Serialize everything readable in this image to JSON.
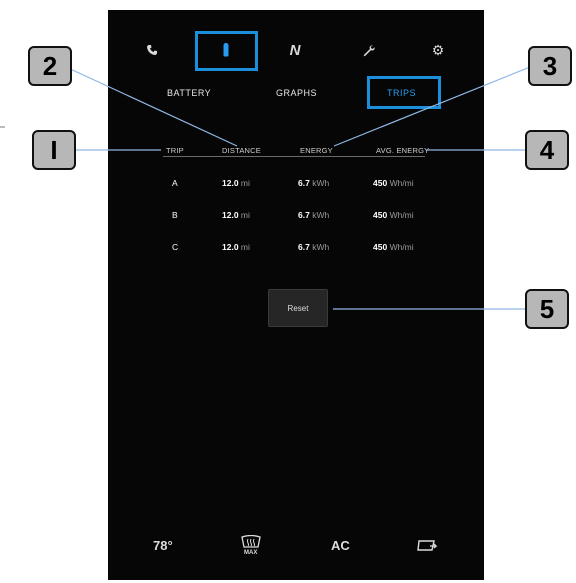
{
  "nav": {
    "icons": [
      "phone-icon",
      "battery-icon",
      "n-logo-icon",
      "wrench-icon",
      "gear-icon"
    ],
    "logo_letter": "N"
  },
  "tabs": [
    {
      "label": "BATTERY"
    },
    {
      "label": "GRAPHS"
    },
    {
      "label": "TRIPS"
    }
  ],
  "table": {
    "columns": [
      "TRIP",
      "DISTANCE",
      "ENERGY",
      "AVG. ENERGY"
    ],
    "rows": [
      {
        "trip": "A",
        "distance": "12.0",
        "distance_unit": "mi",
        "energy": "6.7",
        "energy_unit": "kWh",
        "avg": "450",
        "avg_unit": "Wh/mi"
      },
      {
        "trip": "B",
        "distance": "12.0",
        "distance_unit": "mi",
        "energy": "6.7",
        "energy_unit": "kWh",
        "avg": "450",
        "avg_unit": "Wh/mi"
      },
      {
        "trip": "C",
        "distance": "12.0",
        "distance_unit": "mi",
        "energy": "6.7",
        "energy_unit": "kWh",
        "avg": "450",
        "avg_unit": "Wh/mi"
      }
    ]
  },
  "reset_label": "Reset",
  "bottom": {
    "temperature": "78°",
    "defrost_label": "MAX",
    "ac_label": "AC"
  },
  "callouts": [
    "2",
    "3",
    "I",
    "4",
    "5"
  ],
  "colors": {
    "screen": "#060606",
    "highlight": "#1b8fdc",
    "active_tab": "#2a9cf0"
  }
}
